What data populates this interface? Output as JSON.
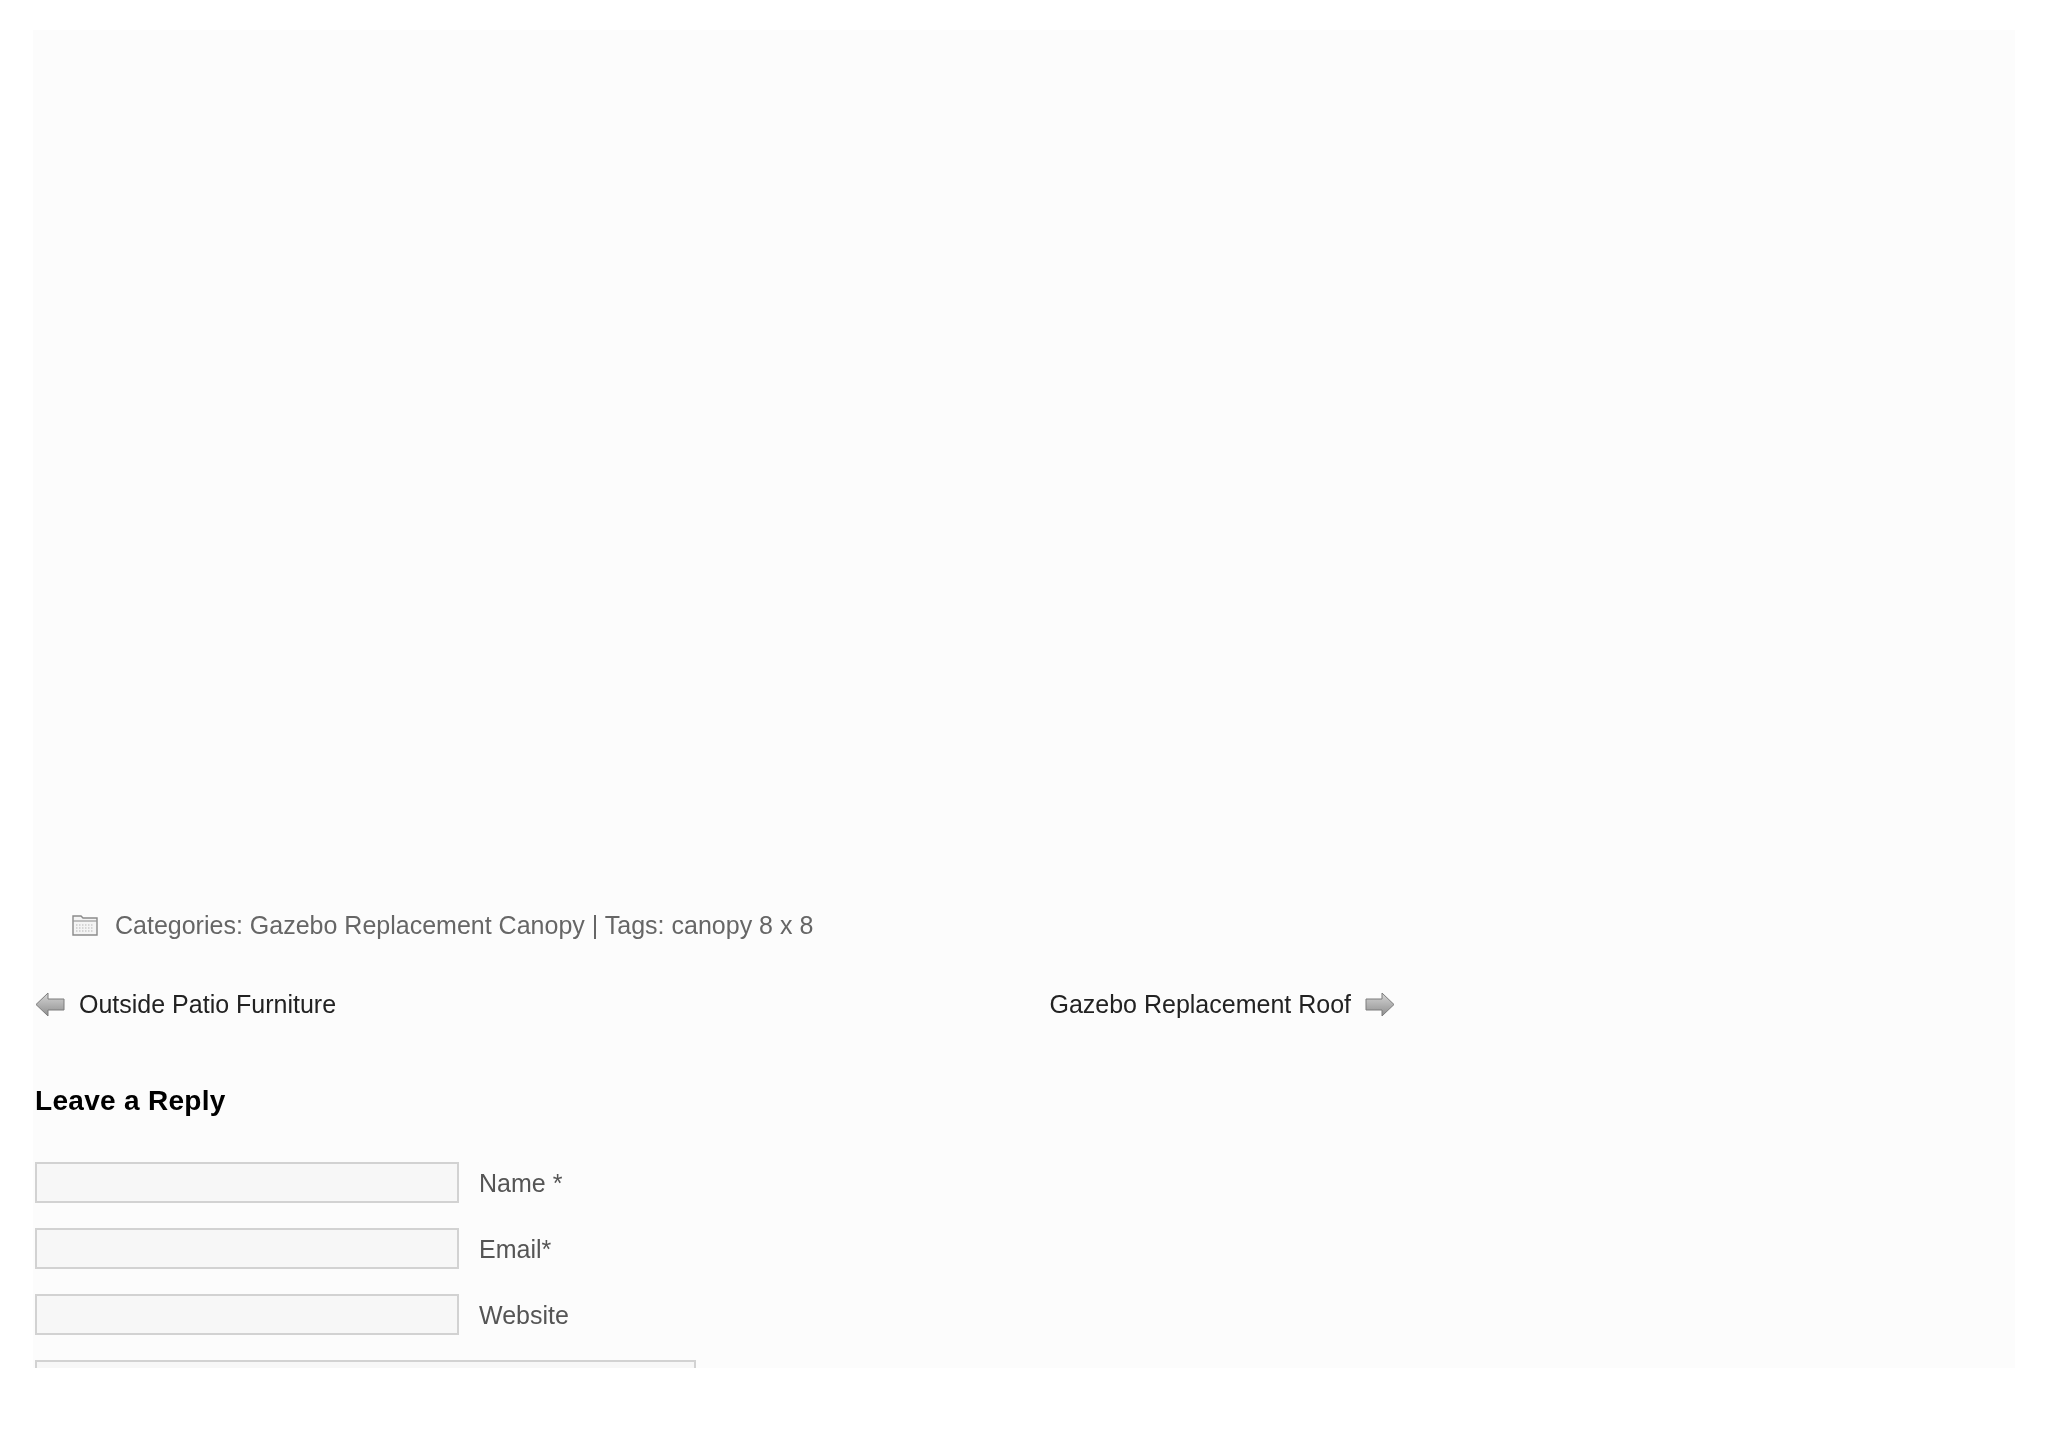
{
  "post_meta": {
    "categories_label": "Categories:",
    "categories": [
      "Gazebo Replacement Canopy"
    ],
    "tags_label": "| Tags:",
    "tags": [
      "canopy 8 x 8"
    ]
  },
  "post_navigation": {
    "previous": {
      "title": "Outside Patio Furniture"
    },
    "next": {
      "title": "Gazebo Replacement Roof"
    }
  },
  "reply_form": {
    "title": "Leave a Reply",
    "fields": [
      {
        "kind": "text",
        "label": "Name *"
      },
      {
        "kind": "text",
        "label": "Email*"
      },
      {
        "kind": "text",
        "label": "Website"
      },
      {
        "kind": "textarea"
      }
    ]
  }
}
